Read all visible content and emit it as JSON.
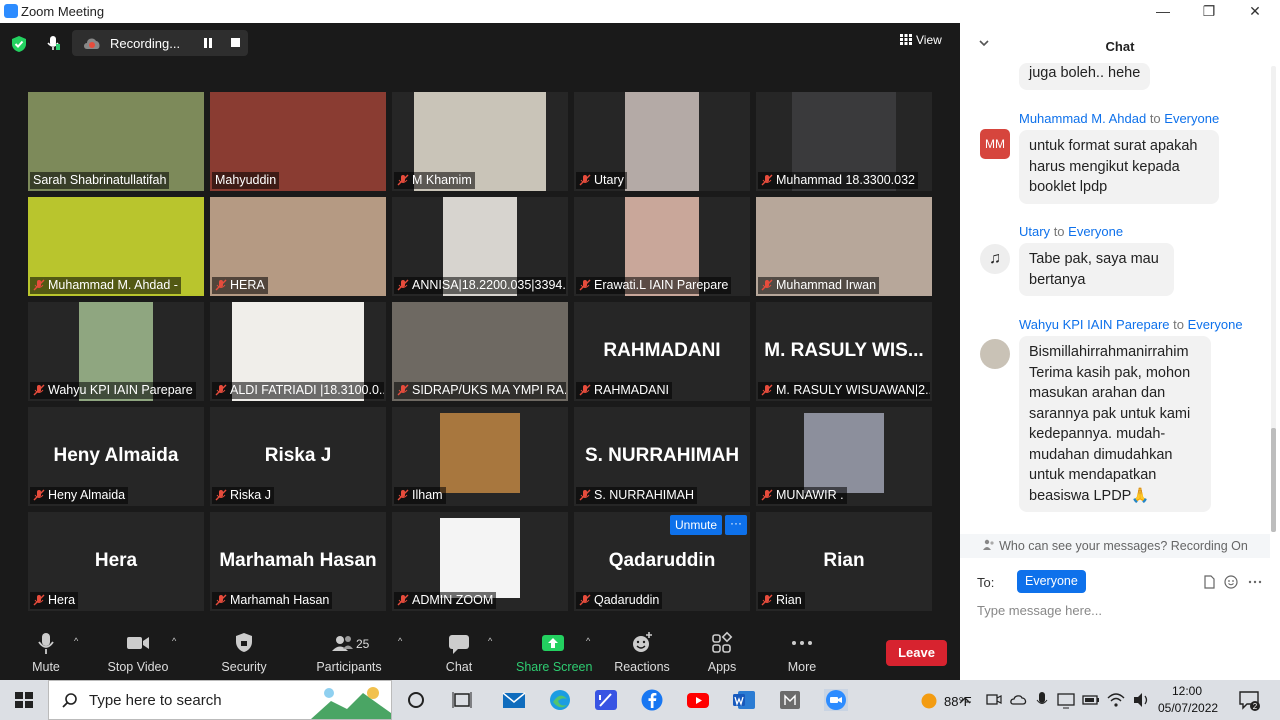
{
  "window": {
    "title": "Zoom Meeting"
  },
  "topbar": {
    "recording_label": "Recording...",
    "view_label": "View"
  },
  "tiles": [
    {
      "label": "Sarah Shabrinatullatifah",
      "muted": false,
      "video": true,
      "vidcolor": "#7d8a5a"
    },
    {
      "label": "Mahyuddin",
      "muted": false,
      "video": true,
      "vidcolor": "#8a3c32",
      "active": true
    },
    {
      "label": "M Khamim",
      "muted": true,
      "video": true,
      "vidcolor": "#c9c4b8"
    },
    {
      "label": "Utary",
      "muted": true,
      "video": true,
      "vidcolor": "#b4aaa6"
    },
    {
      "label": "Muhammad 18.3300.032",
      "muted": true,
      "video": true,
      "vidcolor": "#3a3a3c"
    },
    {
      "label": "Muhammad M. Ahdad -",
      "muted": true,
      "video": true,
      "vidcolor": "#b9c52d"
    },
    {
      "label": "HERA",
      "muted": true,
      "video": true,
      "vidcolor": "#b59a83"
    },
    {
      "label": "ANNISA|18.2200.035|3394...",
      "muted": true,
      "video": true,
      "vidcolor": "#d7d4cf"
    },
    {
      "label": "Erawati.L IAIN Parepare",
      "muted": true,
      "video": true,
      "vidcolor": "#c9a79a"
    },
    {
      "label": "Muhammad Irwan",
      "muted": true,
      "video": true,
      "vidcolor": "#b7a79a"
    },
    {
      "label": "Wahyu KPI IAIN Parepare",
      "muted": true,
      "video": true,
      "vidcolor": "#8fa680"
    },
    {
      "label": "ALDI FATRIADI |18.3100.0...",
      "muted": true,
      "video": true,
      "vidcolor": "#f0eeea"
    },
    {
      "label": "SIDRAP/UKS MA YMPI RA...",
      "muted": true,
      "video": true,
      "vidcolor": "#6e6962"
    },
    {
      "label": "RAHMADANI",
      "muted": true,
      "video": false,
      "bigname": "RAHMADANI"
    },
    {
      "label": "M. RASULY WISUAWAN|2...",
      "muted": true,
      "video": false,
      "bigname": "M. RASULY WIS..."
    },
    {
      "label": "Heny Almaida",
      "muted": true,
      "video": false,
      "bigname": "Heny Almaida"
    },
    {
      "label": "Riska J",
      "muted": true,
      "video": false,
      "bigname": "Riska J"
    },
    {
      "label": "Ilham",
      "muted": true,
      "video": true,
      "vidcolor": "#a8773e"
    },
    {
      "label": "S. NURRAHIMAH",
      "muted": true,
      "video": false,
      "bigname": "S. NURRAHIMAH"
    },
    {
      "label": "MUNAWIR .",
      "muted": true,
      "video": true,
      "vidcolor": "#8c8f9c"
    },
    {
      "label": "Hera",
      "muted": true,
      "video": false,
      "bigname": "Hera"
    },
    {
      "label": "Marhamah Hasan",
      "muted": true,
      "video": false,
      "bigname": "Marhamah Hasan"
    },
    {
      "label": "ADMIN ZOOM",
      "muted": true,
      "video": true,
      "vidcolor": "#f4f4f4"
    },
    {
      "label": "Qadaruddin",
      "muted": true,
      "video": false,
      "bigname": "Qadaruddin"
    },
    {
      "label": "Rian",
      "muted": true,
      "video": false,
      "bigname": "Rian"
    }
  ],
  "hover": {
    "unmute_label": "Unmute",
    "more_label": "···"
  },
  "toolbar": {
    "mute": "Mute",
    "stop_video": "Stop Video",
    "security": "Security",
    "participants": "Participants",
    "participants_count": "25",
    "chat": "Chat",
    "share": "Share Screen",
    "reactions": "Reactions",
    "apps": "Apps",
    "more": "More",
    "leave": "Leave"
  },
  "chat": {
    "title": "Chat",
    "to_everyone": "to",
    "messages": [
      {
        "sender": "",
        "to": "",
        "text": "juga boleh.. hehe"
      },
      {
        "sender": "Muhammad M. Ahdad",
        "to": "Everyone",
        "avatar": "MM",
        "text": "untuk format surat apakah harus mengikut kepada booklet lpdp"
      },
      {
        "sender": "Utary",
        "to": "Everyone",
        "avatar": "♫",
        "text": "Tabe pak, saya mau bertanya"
      },
      {
        "sender": "Wahyu KPI IAIN Parepare",
        "to": "Everyone",
        "text": "Bismillahirrahmanirrahim Terima kasih pak, mohon masukan arahan dan sarannya pak untuk kami kedepannya. mudah-mudahan dimudahkan untuk mendapatkan beasiswa LPDP🙏"
      }
    ],
    "who_can_see": "Who can see your messages? Recording On",
    "to_label": "To:",
    "to_value": "Everyone",
    "input_placeholder": "Type message here..."
  },
  "taskbar": {
    "search_placeholder": "Type here to search",
    "temperature": "88°F",
    "time": "12:00",
    "date": "05/07/2022",
    "notifications": "2"
  }
}
